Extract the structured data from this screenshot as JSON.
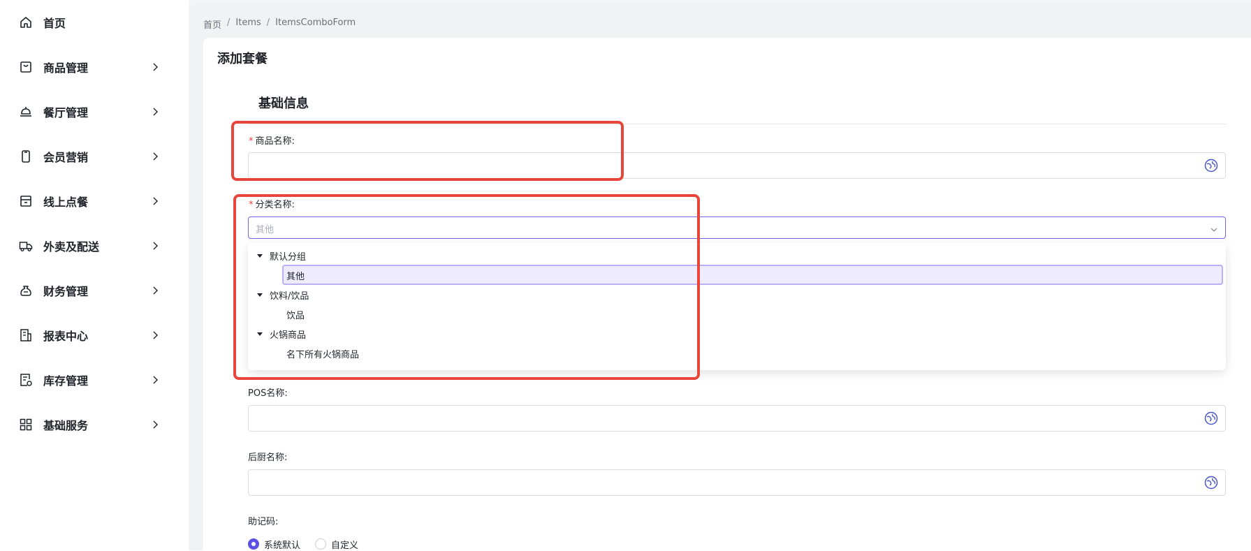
{
  "sidebar": {
    "items": [
      {
        "label": "首页",
        "icon": "home-icon"
      },
      {
        "label": "商品管理",
        "icon": "bag-icon"
      },
      {
        "label": "餐厅管理",
        "icon": "cloche-icon"
      },
      {
        "label": "会员营销",
        "icon": "phone-icon"
      },
      {
        "label": "线上点餐",
        "icon": "store-icon"
      },
      {
        "label": "外卖及配送",
        "icon": "truck-icon"
      },
      {
        "label": "财务管理",
        "icon": "money-bag-icon"
      },
      {
        "label": "报表中心",
        "icon": "report-icon"
      },
      {
        "label": "库存管理",
        "icon": "inventory-icon"
      },
      {
        "label": "基础服务",
        "icon": "grid-icon"
      }
    ]
  },
  "breadcrumb": [
    "首页",
    "Items",
    "ItemsComboForm"
  ],
  "page_title": "添加套餐",
  "section_title": "基础信息",
  "form": {
    "product_name_label": "商品名称:",
    "category_label": "分类名称:",
    "category_placeholder": "其他",
    "pos_name_label": "POS名称:",
    "kitchen_name_label": "后厨名称:",
    "mnemonic_label": "助记码:",
    "mnemonic_options": [
      "系统默认",
      "自定义"
    ],
    "required_mark": "*"
  },
  "dropdown": {
    "groups": [
      {
        "label": "默认分组",
        "children": [
          "其他"
        ]
      },
      {
        "label": "饮料/饮品",
        "children": [
          "饮品"
        ]
      },
      {
        "label": "火锅商品",
        "children": [
          "名下所有火锅商品"
        ]
      }
    ],
    "selected": "其他"
  },
  "colors": {
    "accent": "#5c50e6",
    "highlight_box": "#e8453d",
    "required": "#f53f3f"
  }
}
